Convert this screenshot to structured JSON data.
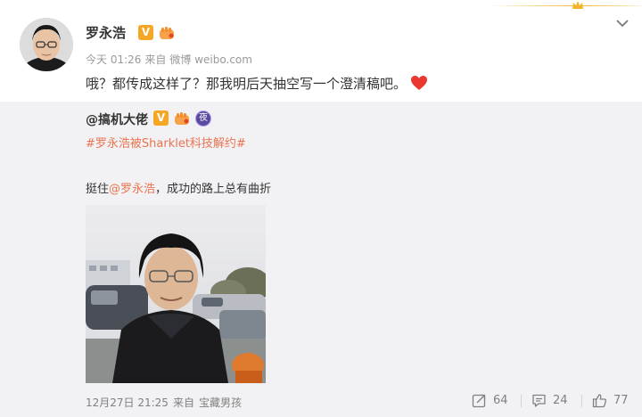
{
  "post": {
    "author": "罗永浩",
    "time": "今天 01:26",
    "source_prefix": "来自",
    "source": "微博 weibo.com",
    "text": "哦？都传成这样了？那我明后天抽空写一个澄清稿吧。",
    "vip_badge": "V"
  },
  "repost": {
    "author": "@搞机大佬",
    "vip_badge": "V",
    "night_badge": "夜",
    "hashtag": "#罗永浩被Sharklet科技解约#",
    "text_before": "挺住",
    "mention": "@罗永浩",
    "text_after": "，成功的路上总有曲折",
    "time": "12月27日 21:25",
    "source_prefix": "来自",
    "source": "宝藏男孩",
    "reposts": "64",
    "comments": "24",
    "likes": "77"
  },
  "colors": {
    "link": "#eb7350",
    "badge": "#f5a623",
    "heart": "#e8382f",
    "repost_bg": "#f2f2f5",
    "meta": "#999999"
  },
  "icons": [
    "chevron-down-icon",
    "crown-icon",
    "heart-icon",
    "repost-icon",
    "comment-icon",
    "like-icon",
    "vip-badge-icon",
    "fist-badge-icon",
    "night-badge-icon"
  ]
}
